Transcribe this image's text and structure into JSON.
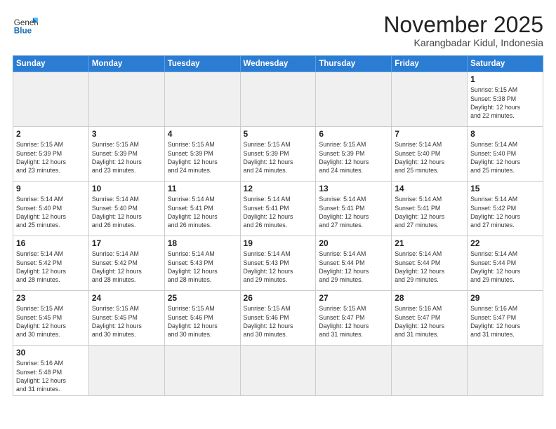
{
  "logo": {
    "text_general": "General",
    "text_blue": "Blue"
  },
  "header": {
    "month": "November 2025",
    "location": "Karangbadar Kidul, Indonesia"
  },
  "days_of_week": [
    "Sunday",
    "Monday",
    "Tuesday",
    "Wednesday",
    "Thursday",
    "Friday",
    "Saturday"
  ],
  "weeks": [
    [
      {
        "day": "",
        "info": ""
      },
      {
        "day": "",
        "info": ""
      },
      {
        "day": "",
        "info": ""
      },
      {
        "day": "",
        "info": ""
      },
      {
        "day": "",
        "info": ""
      },
      {
        "day": "",
        "info": ""
      },
      {
        "day": "1",
        "info": "Sunrise: 5:15 AM\nSunset: 5:38 PM\nDaylight: 12 hours\nand 22 minutes."
      }
    ],
    [
      {
        "day": "2",
        "info": "Sunrise: 5:15 AM\nSunset: 5:39 PM\nDaylight: 12 hours\nand 23 minutes."
      },
      {
        "day": "3",
        "info": "Sunrise: 5:15 AM\nSunset: 5:39 PM\nDaylight: 12 hours\nand 23 minutes."
      },
      {
        "day": "4",
        "info": "Sunrise: 5:15 AM\nSunset: 5:39 PM\nDaylight: 12 hours\nand 24 minutes."
      },
      {
        "day": "5",
        "info": "Sunrise: 5:15 AM\nSunset: 5:39 PM\nDaylight: 12 hours\nand 24 minutes."
      },
      {
        "day": "6",
        "info": "Sunrise: 5:15 AM\nSunset: 5:39 PM\nDaylight: 12 hours\nand 24 minutes."
      },
      {
        "day": "7",
        "info": "Sunrise: 5:14 AM\nSunset: 5:40 PM\nDaylight: 12 hours\nand 25 minutes."
      },
      {
        "day": "8",
        "info": "Sunrise: 5:14 AM\nSunset: 5:40 PM\nDaylight: 12 hours\nand 25 minutes."
      }
    ],
    [
      {
        "day": "9",
        "info": "Sunrise: 5:14 AM\nSunset: 5:40 PM\nDaylight: 12 hours\nand 25 minutes."
      },
      {
        "day": "10",
        "info": "Sunrise: 5:14 AM\nSunset: 5:40 PM\nDaylight: 12 hours\nand 26 minutes."
      },
      {
        "day": "11",
        "info": "Sunrise: 5:14 AM\nSunset: 5:41 PM\nDaylight: 12 hours\nand 26 minutes."
      },
      {
        "day": "12",
        "info": "Sunrise: 5:14 AM\nSunset: 5:41 PM\nDaylight: 12 hours\nand 26 minutes."
      },
      {
        "day": "13",
        "info": "Sunrise: 5:14 AM\nSunset: 5:41 PM\nDaylight: 12 hours\nand 27 minutes."
      },
      {
        "day": "14",
        "info": "Sunrise: 5:14 AM\nSunset: 5:41 PM\nDaylight: 12 hours\nand 27 minutes."
      },
      {
        "day": "15",
        "info": "Sunrise: 5:14 AM\nSunset: 5:42 PM\nDaylight: 12 hours\nand 27 minutes."
      }
    ],
    [
      {
        "day": "16",
        "info": "Sunrise: 5:14 AM\nSunset: 5:42 PM\nDaylight: 12 hours\nand 28 minutes."
      },
      {
        "day": "17",
        "info": "Sunrise: 5:14 AM\nSunset: 5:42 PM\nDaylight: 12 hours\nand 28 minutes."
      },
      {
        "day": "18",
        "info": "Sunrise: 5:14 AM\nSunset: 5:43 PM\nDaylight: 12 hours\nand 28 minutes."
      },
      {
        "day": "19",
        "info": "Sunrise: 5:14 AM\nSunset: 5:43 PM\nDaylight: 12 hours\nand 29 minutes."
      },
      {
        "day": "20",
        "info": "Sunrise: 5:14 AM\nSunset: 5:44 PM\nDaylight: 12 hours\nand 29 minutes."
      },
      {
        "day": "21",
        "info": "Sunrise: 5:14 AM\nSunset: 5:44 PM\nDaylight: 12 hours\nand 29 minutes."
      },
      {
        "day": "22",
        "info": "Sunrise: 5:14 AM\nSunset: 5:44 PM\nDaylight: 12 hours\nand 29 minutes."
      }
    ],
    [
      {
        "day": "23",
        "info": "Sunrise: 5:15 AM\nSunset: 5:45 PM\nDaylight: 12 hours\nand 30 minutes."
      },
      {
        "day": "24",
        "info": "Sunrise: 5:15 AM\nSunset: 5:45 PM\nDaylight: 12 hours\nand 30 minutes."
      },
      {
        "day": "25",
        "info": "Sunrise: 5:15 AM\nSunset: 5:46 PM\nDaylight: 12 hours\nand 30 minutes."
      },
      {
        "day": "26",
        "info": "Sunrise: 5:15 AM\nSunset: 5:46 PM\nDaylight: 12 hours\nand 30 minutes."
      },
      {
        "day": "27",
        "info": "Sunrise: 5:15 AM\nSunset: 5:47 PM\nDaylight: 12 hours\nand 31 minutes."
      },
      {
        "day": "28",
        "info": "Sunrise: 5:16 AM\nSunset: 5:47 PM\nDaylight: 12 hours\nand 31 minutes."
      },
      {
        "day": "29",
        "info": "Sunrise: 5:16 AM\nSunset: 5:47 PM\nDaylight: 12 hours\nand 31 minutes."
      }
    ],
    [
      {
        "day": "30",
        "info": "Sunrise: 5:16 AM\nSunset: 5:48 PM\nDaylight: 12 hours\nand 31 minutes."
      },
      {
        "day": "",
        "info": ""
      },
      {
        "day": "",
        "info": ""
      },
      {
        "day": "",
        "info": ""
      },
      {
        "day": "",
        "info": ""
      },
      {
        "day": "",
        "info": ""
      },
      {
        "day": "",
        "info": ""
      }
    ]
  ]
}
